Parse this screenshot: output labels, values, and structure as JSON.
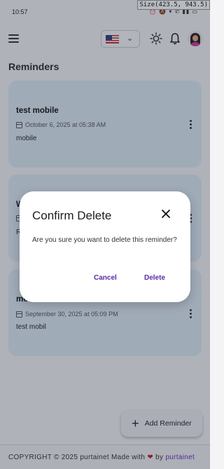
{
  "status_bar": {
    "time": "10:57",
    "icons": [
      "alarm-icon",
      "mute-icon",
      "wifi-icon",
      "call-icon",
      "signal-icon",
      "battery-icon"
    ]
  },
  "size_badge": "Size(423.5, 943.5)",
  "header": {
    "language": {
      "selected": "United States",
      "flag_icon": "us-flag-icon"
    },
    "icons": [
      "menu-icon",
      "sun-icon",
      "bell-icon",
      "avatar"
    ]
  },
  "main": {
    "title": "Reminders",
    "reminders": [
      {
        "title": "test mobile",
        "date": "October 6, 2025 at 05:38 AM",
        "description": "mobile"
      },
      {
        "title": "W",
        "date": "",
        "description": "R"
      },
      {
        "title": "mo",
        "date": "September 30, 2025 at 05:09 PM",
        "description": "test mobil"
      }
    ]
  },
  "fab": {
    "label": "Add Reminder"
  },
  "footer": {
    "prefix": "COPYRIGHT © 2025 purtainet Made with",
    "suffix": "by",
    "brand": "purtainet"
  },
  "dialog": {
    "title": "Confirm Delete",
    "message": "Are you sure you want to delete this reminder?",
    "cancel_label": "Cancel",
    "delete_label": "Delete"
  },
  "colors": {
    "accent": "#5b2aa8",
    "card_bg": "#dde9f5",
    "heart": "#c01d2a"
  }
}
